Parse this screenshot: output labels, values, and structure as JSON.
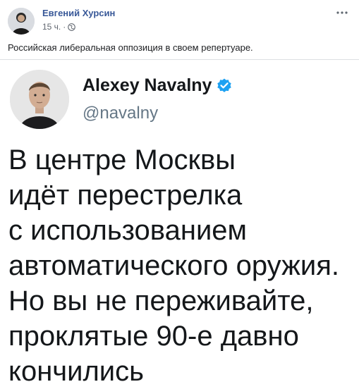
{
  "post": {
    "author": "Евгений Хурсин",
    "time": "15 ч.",
    "separator": "·",
    "privacy_icon": "globe-icon",
    "text": "Российская либеральная оппозиция в своем репертуаре.",
    "more_icon": "more-dots-icon"
  },
  "tweet": {
    "name": "Alexey Navalny",
    "handle": "@navalny",
    "verified_icon": "verified-badge-icon",
    "lines": [
      "В центре Москвы",
      "идёт перестрелка",
      "с использованием",
      "автоматического оружия.",
      "Но вы не переживайте,",
      "проклятые 90-е давно",
      "кончились"
    ]
  },
  "colors": {
    "author_link": "#385898",
    "meta_gray": "#616770",
    "verified_blue": "#1da1f2",
    "handle_gray": "#657786"
  }
}
